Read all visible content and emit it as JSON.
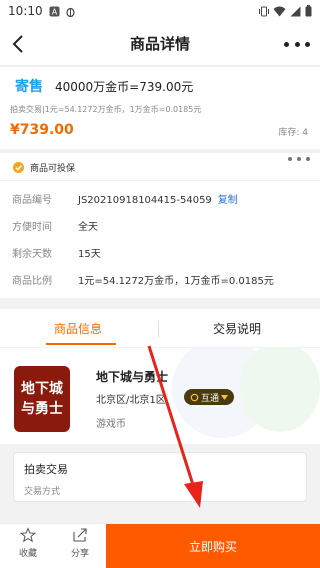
{
  "status_bar": {
    "time": "10:10"
  },
  "nav": {
    "title": "商品详情"
  },
  "product": {
    "logo_text": "寄售",
    "name": "40000万金币=739.00元",
    "subtitle": "拍卖交易|1元=54.1272万金币，1万金币=0.0185元",
    "price": "¥739.00",
    "stock": "库存: 4"
  },
  "guarantee": {
    "label": "商品可投保"
  },
  "info_rows": [
    {
      "key": "商品编号",
      "value": "JS20210918104415-54059",
      "link": "复制"
    },
    {
      "key": "方便时间",
      "value": "全天"
    },
    {
      "key": "剩余天数",
      "value": "15天"
    },
    {
      "key": "商品比例",
      "value": "1元=54.1272万金币，1万金币=0.0185元"
    }
  ],
  "tabs": [
    {
      "label": "商品信息",
      "active": true
    },
    {
      "label": "交易说明",
      "active": false
    }
  ],
  "game": {
    "icon_line1": "地下城",
    "icon_line2": "与勇士",
    "name": "地下城与勇士",
    "region": "北京区/北京1区",
    "badge": "互通",
    "type": "游戏币"
  },
  "trade": {
    "method": "拍卖交易",
    "method_label": "交易方式"
  },
  "bottom": {
    "favorite": "收藏",
    "share": "分享",
    "buy": "立即购买"
  },
  "colors": {
    "accent": "#f26b00",
    "buy_button": "#ff5a00",
    "link": "#2b73d9",
    "game_icon_bg": "#8a1a0c"
  }
}
